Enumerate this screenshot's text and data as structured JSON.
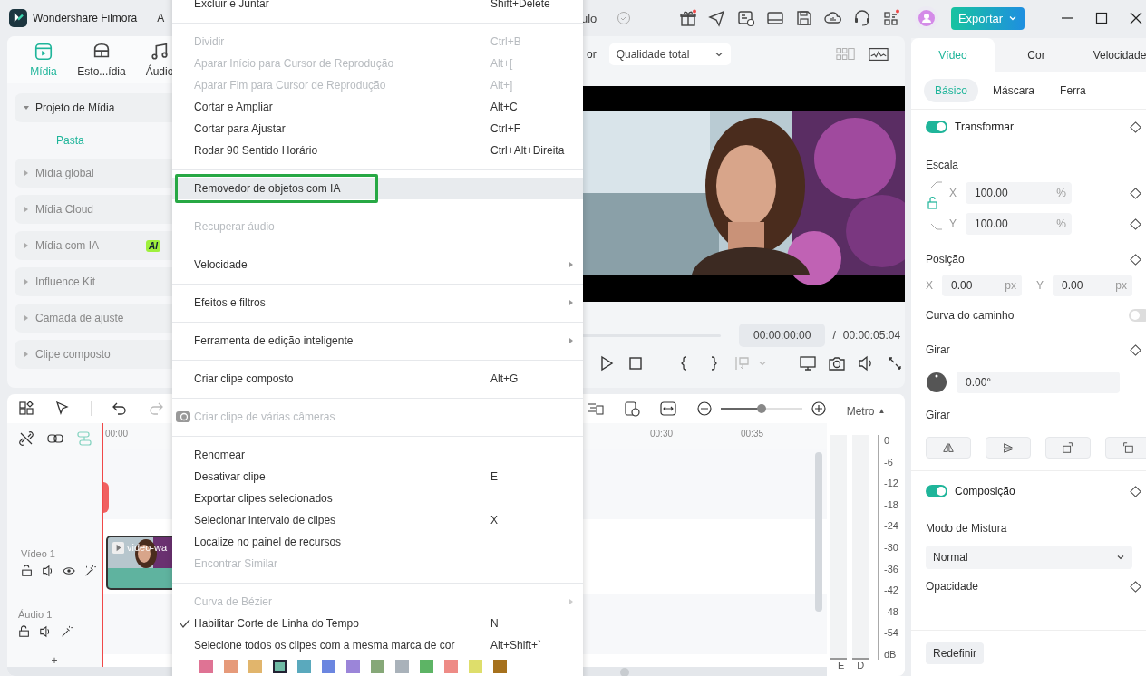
{
  "app": {
    "title": "Wondershare Filmora",
    "menu_fragment": "A",
    "project_fragment": "ulo",
    "export_button": "Exportar"
  },
  "media_panel": {
    "tabs": [
      {
        "label": "Mídia",
        "selected": true
      },
      {
        "label": "Esto...ídia",
        "selected": false
      },
      {
        "label": "Áudio",
        "selected": false
      }
    ],
    "groups": [
      {
        "label": "Projeto de Mídia",
        "expanded": true,
        "children": [
          {
            "label": "Pasta",
            "selected": true
          }
        ]
      },
      {
        "label": "Mídia global",
        "expanded": false
      },
      {
        "label": "Mídia Cloud",
        "expanded": false
      },
      {
        "label": "Mídia com IA",
        "expanded": false,
        "badge": "AI"
      },
      {
        "label": "Influence Kit",
        "expanded": false
      },
      {
        "label": "Camada de ajuste",
        "expanded": false
      },
      {
        "label": "Clipe composto",
        "expanded": false
      }
    ]
  },
  "preview": {
    "label_fragment": "or",
    "quality": "Qualidade total",
    "current_time": "00:00:00:00",
    "separator": "/",
    "duration": "00:00:05:04"
  },
  "inspector": {
    "tabs": [
      {
        "label": "Vídeo",
        "selected": true
      },
      {
        "label": "Cor",
        "selected": false
      },
      {
        "label": "Velocidade",
        "selected": false
      }
    ],
    "subtabs": [
      {
        "label": "Básico",
        "selected": true
      },
      {
        "label": "Máscara",
        "selected": false
      },
      {
        "label": "Ferra",
        "selected": false
      }
    ],
    "transform": {
      "label": "Transformar",
      "on": true
    },
    "scale_label": "Escala",
    "scale": [
      {
        "axis": "X",
        "value": "100.00",
        "unit": "%"
      },
      {
        "axis": "Y",
        "value": "100.00",
        "unit": "%"
      }
    ],
    "position_label": "Posição",
    "position": [
      {
        "axis": "X",
        "value": "0.00",
        "unit": "px"
      },
      {
        "axis": "Y",
        "value": "0.00",
        "unit": "px"
      }
    ],
    "path_curve": {
      "label": "Curva do caminho",
      "on": false
    },
    "rotate_label": "Girar",
    "rotate_value": "0.00°",
    "flip_label": "Girar",
    "composition": {
      "label": "Composição",
      "on": true
    },
    "blend_label": "Modo de Mistura",
    "blend_value": "Normal",
    "opacity_label": "Opacidade",
    "reset_button": "Redefinir"
  },
  "timeline": {
    "ruler": [
      "00:00",
      "00:30",
      "00:35"
    ],
    "tracks": [
      {
        "name": "Vídeo 1",
        "kind": "video"
      },
      {
        "name": "Áudio 1",
        "kind": "audio"
      }
    ],
    "clip": {
      "title": "video-wa"
    },
    "zoom": {
      "level": 0.5
    },
    "add": "+",
    "meter": {
      "label": "Metro",
      "toggle": "▲",
      "scale": [
        "0",
        "-6",
        "-12",
        "-18",
        "-24",
        "-30",
        "-36",
        "-42",
        "-48",
        "-54",
        "dB"
      ],
      "channels": [
        "E",
        "D"
      ]
    }
  },
  "context_menu": {
    "sections": [
      {
        "items": [
          {
            "kind": "item",
            "label": "Excluir e Juntar",
            "shortcut": "Shift+Delete",
            "disabled": false,
            "selected": false,
            "checked": false,
            "submenu": false
          }
        ]
      },
      {
        "items": [
          {
            "kind": "item",
            "label": "Dividir",
            "shortcut": "Ctrl+B",
            "disabled": true,
            "selected": false,
            "checked": false,
            "submenu": false
          },
          {
            "kind": "item",
            "label": "Aparar Início para Cursor de Reprodução",
            "shortcut": "Alt+[",
            "disabled": true,
            "selected": false,
            "checked": false,
            "submenu": false
          },
          {
            "kind": "item",
            "label": "Aparar Fim para Cursor de Reprodução",
            "shortcut": "Alt+]",
            "disabled": true,
            "selected": false,
            "checked": false,
            "submenu": false
          },
          {
            "kind": "item",
            "label": "Cortar e Ampliar",
            "shortcut": "Alt+C",
            "disabled": false,
            "selected": false,
            "checked": false,
            "submenu": false
          },
          {
            "kind": "item",
            "label": "Cortar para Ajustar",
            "shortcut": "Ctrl+F",
            "disabled": false,
            "selected": false,
            "checked": false,
            "submenu": false
          },
          {
            "kind": "item",
            "label": "Rodar 90 Sentido Horário",
            "shortcut": "Ctrl+Alt+Direita",
            "disabled": false,
            "selected": false,
            "checked": false,
            "submenu": false
          }
        ]
      },
      {
        "items": [
          {
            "kind": "item",
            "label": "Removedor de objetos com IA",
            "disabled": false,
            "selected": true,
            "checked": false,
            "submenu": false
          }
        ]
      },
      {
        "items": [
          {
            "kind": "item",
            "label": "Recuperar áudio",
            "disabled": true,
            "selected": false,
            "checked": false,
            "submenu": false
          }
        ]
      },
      {
        "items": [
          {
            "kind": "item",
            "label": "Velocidade",
            "disabled": false,
            "selected": false,
            "checked": false,
            "submenu": true
          }
        ]
      },
      {
        "items": [
          {
            "kind": "item",
            "label": "Efeitos e filtros",
            "disabled": false,
            "selected": false,
            "checked": false,
            "submenu": true
          }
        ]
      },
      {
        "items": [
          {
            "kind": "item",
            "label": "Ferramenta de edição inteligente",
            "disabled": false,
            "selected": false,
            "checked": false,
            "submenu": true
          }
        ]
      },
      {
        "items": [
          {
            "kind": "item",
            "label": "Criar clipe composto",
            "shortcut": "Alt+G",
            "disabled": false,
            "selected": false,
            "checked": false,
            "submenu": false
          }
        ]
      },
      {
        "items": [
          {
            "kind": "camera_item",
            "label": "Criar clipe de várias câmeras",
            "disabled": true,
            "selected": false,
            "checked": false,
            "submenu": false
          }
        ]
      },
      {
        "items": [
          {
            "kind": "item",
            "label": "Renomear",
            "disabled": false,
            "selected": false,
            "checked": false,
            "submenu": false
          },
          {
            "kind": "item",
            "label": "Desativar clipe",
            "shortcut": "E",
            "disabled": false,
            "selected": false,
            "checked": false,
            "submenu": false
          },
          {
            "kind": "item",
            "label": "Exportar clipes selecionados",
            "disabled": false,
            "selected": false,
            "checked": false,
            "submenu": false
          },
          {
            "kind": "item",
            "label": "Selecionar intervalo de clipes",
            "shortcut": "X",
            "disabled": false,
            "selected": false,
            "checked": false,
            "submenu": false
          },
          {
            "kind": "item",
            "label": "Localize no painel de recursos",
            "disabled": false,
            "selected": false,
            "checked": false,
            "submenu": false
          },
          {
            "kind": "item",
            "label": "Encontrar Similar",
            "disabled": true,
            "selected": false,
            "checked": false,
            "submenu": false
          }
        ]
      },
      {
        "items": [
          {
            "kind": "item",
            "label": "Curva de Bézier",
            "disabled": true,
            "selected": false,
            "checked": false,
            "submenu": true
          },
          {
            "kind": "item",
            "label": "Habilitar Corte de Linha do Tempo",
            "shortcut": "N",
            "disabled": false,
            "selected": false,
            "checked": true,
            "submenu": false
          },
          {
            "kind": "item",
            "label": "Selecione todos os clipes com a mesma marca de cor",
            "shortcut": "Alt+Shift+`",
            "disabled": false,
            "selected": false,
            "checked": false,
            "submenu": false
          },
          {
            "kind": "swatches",
            "swatches": [
              {
                "color": "#df7394",
                "selected": false
              },
              {
                "color": "#e69a7a",
                "selected": false
              },
              {
                "color": "#e1b56c",
                "selected": false
              },
              {
                "color": "#6fbaa5",
                "selected": true
              },
              {
                "color": "#5aa9bd",
                "selected": false
              },
              {
                "color": "#6b86e0",
                "selected": false
              },
              {
                "color": "#9b85d9",
                "selected": false
              },
              {
                "color": "#86a878",
                "selected": false
              },
              {
                "color": "#a9b2ba",
                "selected": false
              },
              {
                "color": "#5db465",
                "selected": false
              },
              {
                "color": "#ee8b86",
                "selected": false
              },
              {
                "color": "#dede6b",
                "selected": false
              },
              {
                "color": "#a6711c",
                "selected": false
              }
            ]
          }
        ]
      }
    ]
  }
}
